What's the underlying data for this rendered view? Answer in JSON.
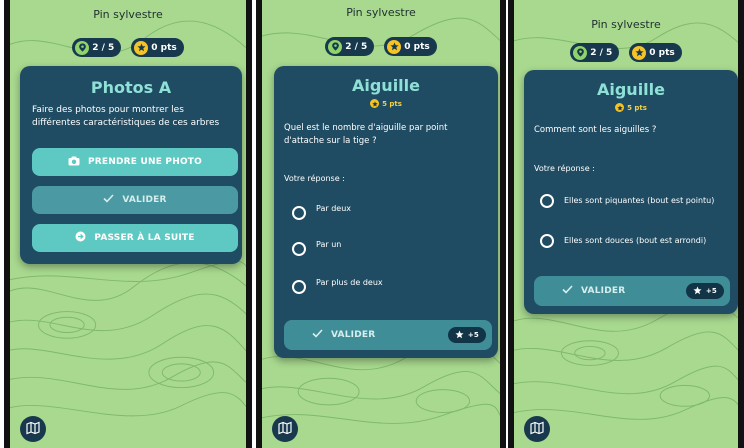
{
  "screens": [
    {
      "title": "Pin sylvestre",
      "progress": "2 / 5",
      "points": "0 pts",
      "card_title": "Photos A",
      "description": "Faire des photos pour montrer les différentes caractéristiques de ces arbres",
      "buttons": {
        "photo": "PRENDRE UNE PHOTO",
        "validate": "VALIDER",
        "next": "PASSER À LA SUITE"
      }
    },
    {
      "title": "Pin sylvestre",
      "progress": "2 / 5",
      "points": "0 pts",
      "card_title": "Aiguille",
      "question_points": "5 pts",
      "question": "Quel est le nombre d'aiguille par point d'attache sur la tige ?",
      "answer_label": "Votre réponse :",
      "options": [
        "Par deux",
        "Par un",
        "Par plus de deux"
      ],
      "validate": "VALIDER",
      "reward": "+5"
    },
    {
      "title": "Pin sylvestre",
      "progress": "2 / 5",
      "points": "0 pts",
      "card_title": "Aiguille",
      "question_points": "5 pts",
      "question": "Comment sont les aiguilles ?",
      "answer_label": "Votre réponse :",
      "options": [
        "Elles sont piquantes (bout est pointu)",
        "Elles sont douces (bout est arrondi)"
      ],
      "validate": "VALIDER",
      "reward": "+5"
    }
  ],
  "icons": {
    "pin": "location-pin-icon",
    "star": "star-icon",
    "camera": "camera-icon",
    "check": "check-icon",
    "arrow": "arrow-right-circle-icon",
    "map": "map-icon"
  },
  "colors": {
    "background": "#a8d98f",
    "card": "#1f4c63",
    "accent": "#5ec9c2",
    "title": "#8fe0d6",
    "star": "#f4c325",
    "dark": "#17384d"
  }
}
